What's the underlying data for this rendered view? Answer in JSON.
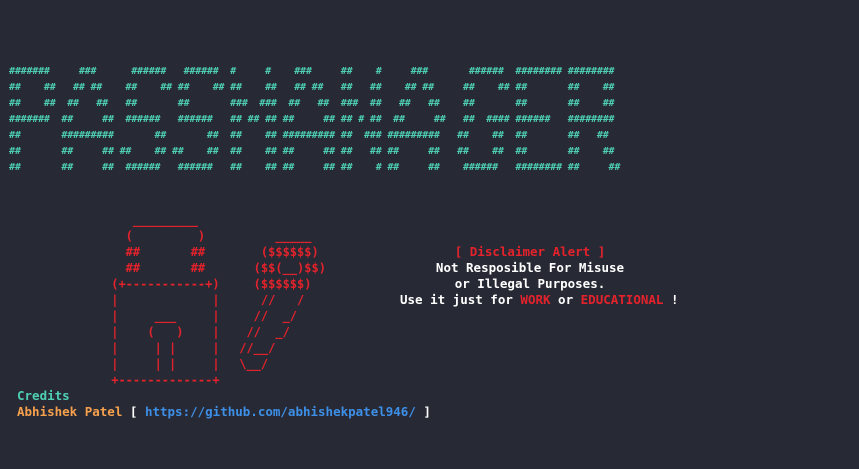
{
  "banner": {
    "ascii": "#######     ###      ######   ######  #     #    ###     ##    #     ###       ######  ######## ########\n##    ##   ## ##    ##    ## ##    ## ##    ##   ## ##   ##   ##    ## ##     ##    ## ##       ##    ##\n##    ##  ##   ##   ##       ##       ###  ###  ##   ##  ###  ##   ##   ##    ##       ##       ##    ##\n#######  ##     ##  ######   ######   ## ## ## ##     ## ## # ##  ##     ##   ##  #### ######   ########\n##       #########       ##       ##  ##    ## ######### ##  ### #########   ##    ##  ##       ##   ##\n##       ##     ## ##    ## ##    ##  ##    ## ##     ## ##   ## ##     ##   ##    ##  ##       ##    ##\n##       ##     ##  ######   ######   ##    ## ##     ## ##    # ##     ##    ######   ######## ##     ##",
    "color": "#4ecfb4"
  },
  "padlock": {
    "ascii": "    _________\n   (         )\n   ##       ##\n   ##       ##\n (+-----------+)\n |             |\n |     ___     |\n |    (   )    |\n |     | |     |\n |     | |     |\n +-------------+",
    "color": "#e5222b"
  },
  "cash": {
    "ascii": "      _____\n    ($$$$$$)\n   ($$(__)$$)\n   ($$$$$$)\n    //   /\n   //  _/\n  //  _/\n //__/\n \\__/",
    "color": "#e5222b"
  },
  "disclaimer": {
    "title": "[ Disclaimer Alert ]",
    "line1": "Not Resposible For Misuse",
    "line2": "or Illegal Purposes.",
    "line3_prefix": "Use it just for ",
    "line3_work": "WORK",
    "line3_or": " or ",
    "line3_edu": "EDUCATIONAL",
    "line3_suffix": " !"
  },
  "credits": {
    "title": "Credits",
    "author": "Abhishek Patel",
    "bracket_open": " [ ",
    "link": "https://github.com/abhishekpatel946/",
    "bracket_close": " ]"
  },
  "colors": {
    "background": "#272a35",
    "teal": "#4ecfb4",
    "red": "#e5222b",
    "orange": "#f6a04d",
    "blue": "#3d8fe8",
    "white": "#ffffff"
  }
}
